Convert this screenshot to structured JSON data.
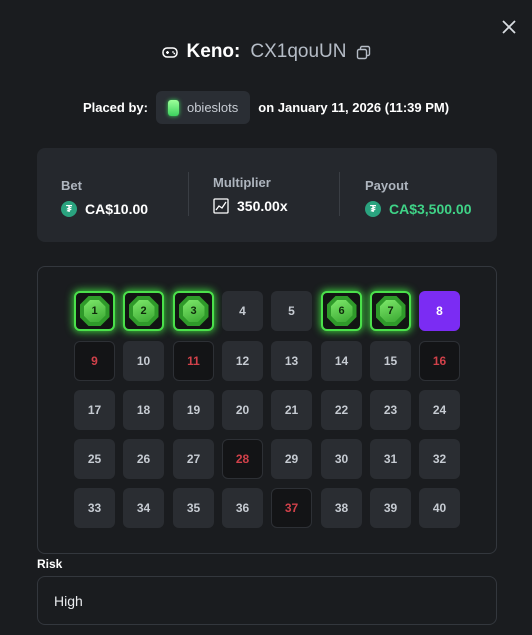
{
  "title": {
    "game": "Keno:",
    "bet_id": "CX1qouUN"
  },
  "placed": {
    "prefix": "Placed by:",
    "username": "obieslots",
    "date_text": "on January 11, 2026 (11:39 PM)"
  },
  "stats": {
    "bet": {
      "label": "Bet",
      "value": "CA$10.00"
    },
    "multiplier": {
      "label": "Multiplier",
      "value": "350.00x"
    },
    "payout": {
      "label": "Payout",
      "value": "CA$3,500.00"
    }
  },
  "board": {
    "tiles": [
      {
        "n": "1",
        "state": "hit"
      },
      {
        "n": "2",
        "state": "hit"
      },
      {
        "n": "3",
        "state": "hit"
      },
      {
        "n": "4",
        "state": "normal"
      },
      {
        "n": "5",
        "state": "normal"
      },
      {
        "n": "6",
        "state": "hit"
      },
      {
        "n": "7",
        "state": "hit"
      },
      {
        "n": "8",
        "state": "purple"
      },
      {
        "n": "9",
        "state": "miss"
      },
      {
        "n": "10",
        "state": "normal"
      },
      {
        "n": "11",
        "state": "miss"
      },
      {
        "n": "12",
        "state": "normal"
      },
      {
        "n": "13",
        "state": "normal"
      },
      {
        "n": "14",
        "state": "normal"
      },
      {
        "n": "15",
        "state": "normal"
      },
      {
        "n": "16",
        "state": "miss"
      },
      {
        "n": "17",
        "state": "normal"
      },
      {
        "n": "18",
        "state": "normal"
      },
      {
        "n": "19",
        "state": "normal"
      },
      {
        "n": "20",
        "state": "normal"
      },
      {
        "n": "21",
        "state": "normal"
      },
      {
        "n": "22",
        "state": "normal"
      },
      {
        "n": "23",
        "state": "normal"
      },
      {
        "n": "24",
        "state": "normal"
      },
      {
        "n": "25",
        "state": "normal"
      },
      {
        "n": "26",
        "state": "normal"
      },
      {
        "n": "27",
        "state": "normal"
      },
      {
        "n": "28",
        "state": "miss"
      },
      {
        "n": "29",
        "state": "normal"
      },
      {
        "n": "30",
        "state": "normal"
      },
      {
        "n": "31",
        "state": "normal"
      },
      {
        "n": "32",
        "state": "normal"
      },
      {
        "n": "33",
        "state": "normal"
      },
      {
        "n": "34",
        "state": "normal"
      },
      {
        "n": "35",
        "state": "normal"
      },
      {
        "n": "36",
        "state": "normal"
      },
      {
        "n": "37",
        "state": "miss"
      },
      {
        "n": "38",
        "state": "normal"
      },
      {
        "n": "39",
        "state": "normal"
      },
      {
        "n": "40",
        "state": "normal"
      }
    ]
  },
  "risk": {
    "label": "Risk",
    "value": "High"
  },
  "colors": {
    "accent_purple": "#7b2cf3",
    "hit_green": "#4be04b",
    "payout_green": "#3fd387",
    "miss_red": "#d1414a"
  },
  "icons": {
    "close": "close-icon",
    "game": "gamepad-icon",
    "copy": "copy-icon",
    "currency": "tether-coin-icon",
    "multiplier": "trend-chart-icon",
    "user": "gem-badge-icon"
  }
}
